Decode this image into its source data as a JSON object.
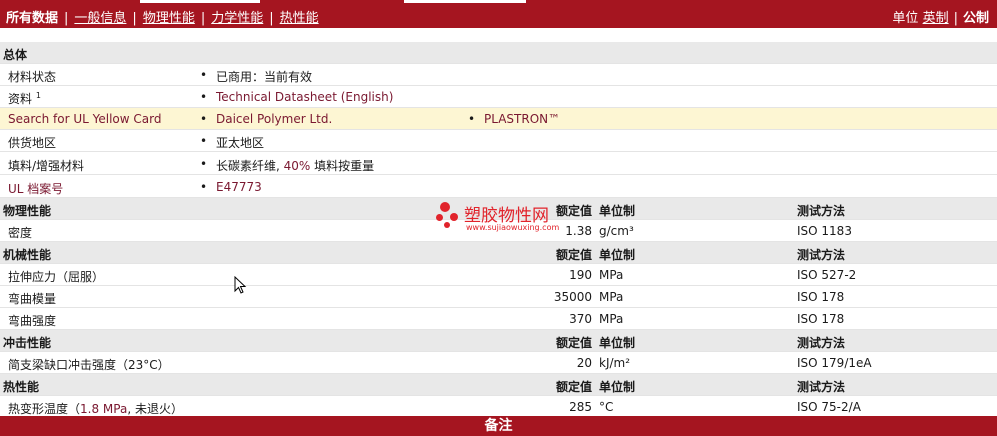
{
  "topnav": {
    "active": "所有数据",
    "links": [
      "一般信息",
      "物理性能",
      "力学性能",
      "热性能"
    ],
    "units_label": "单位",
    "unit_imperial": "英制",
    "unit_metric": "公制"
  },
  "general": {
    "section_title": "总体",
    "rows": [
      {
        "label": "材料状态",
        "value": "已商用：当前有效"
      },
      {
        "label": "资料",
        "sup": "1",
        "value": "Technical Datasheet (English)"
      },
      {
        "label": "Search for UL Yellow Card",
        "value": "Daicel Polymer Ltd.",
        "value2": "PLASTRON™"
      },
      {
        "label": "供货地区",
        "value": "亚太地区"
      },
      {
        "label": "填料/增强材料",
        "value_a": "长碳素纤维, ",
        "value_b": "40%",
        "value_c": " 填料按重量"
      },
      {
        "label": "UL 档案号",
        "value": "E47773"
      }
    ]
  },
  "headers": {
    "nominal": "额定值",
    "unit": "单位制",
    "method": "测试方法"
  },
  "sections": {
    "physical": {
      "title": "物理性能",
      "rows": [
        {
          "label": "密度",
          "value": "1.38",
          "unit": "g/cm³",
          "method": "ISO 1183"
        }
      ]
    },
    "mechanical": {
      "title": "机械性能",
      "rows": [
        {
          "label": "拉伸应力（屈服）",
          "value": "190",
          "unit": "MPa",
          "method": "ISO 527-2"
        },
        {
          "label": "弯曲模量",
          "value": "35000",
          "unit": "MPa",
          "method": "ISO 178"
        },
        {
          "label": "弯曲强度",
          "value": "370",
          "unit": "MPa",
          "method": "ISO 178"
        }
      ]
    },
    "impact": {
      "title": "冲击性能",
      "rows": [
        {
          "label": "简支梁缺口冲击强度（23°C）",
          "value": "20",
          "unit": "kJ/m²",
          "method": "ISO 179/1eA"
        }
      ]
    },
    "thermal": {
      "title": "热性能",
      "rows": [
        {
          "label_a": "热变形温度（",
          "label_b": "1.8 MPa",
          "label_c": ", 未退火）",
          "value": "285",
          "unit": "°C",
          "method": "ISO 75-2/A"
        }
      ]
    }
  },
  "footer": {
    "title": "备注"
  },
  "watermark": {
    "name": "塑胶物性网",
    "url": "www.sujiaowuxing.com"
  },
  "colors": {
    "brand": "#a51520",
    "link": "#7a1830",
    "highlight_row": "#fdf6d3"
  }
}
